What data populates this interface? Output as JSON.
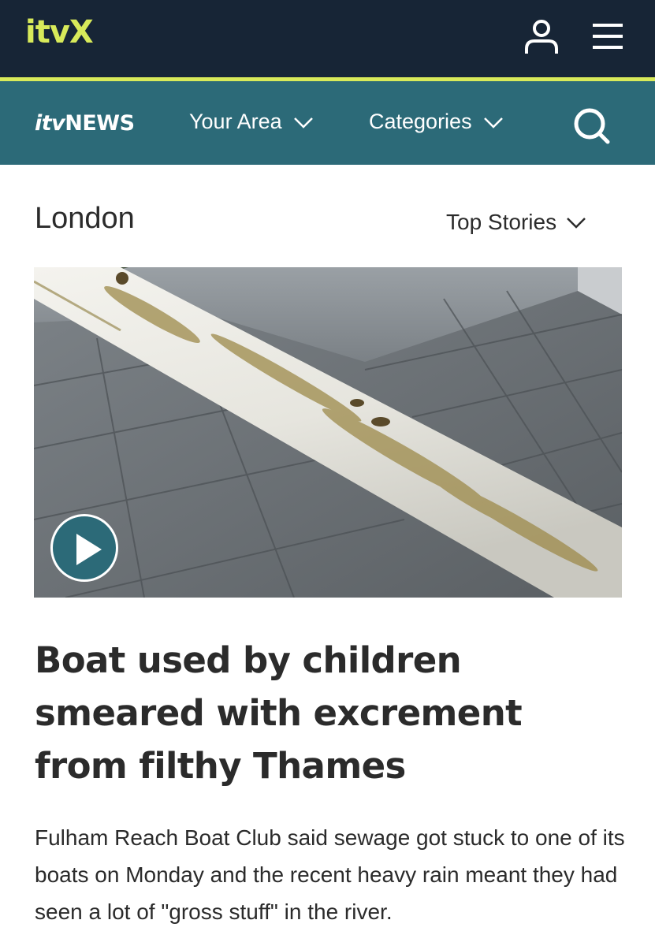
{
  "brand": {
    "logo_text": "itvX",
    "colors": {
      "topbar": "#172536",
      "accent": "#d8ea5a",
      "newsbar": "#2c6a78"
    }
  },
  "header": {
    "account_icon": "person-icon",
    "menu_icon": "hamburger-menu-icon"
  },
  "news_nav": {
    "logo_text_prefix": "itv",
    "logo_text_suffix": "NEWS",
    "items": [
      {
        "label": "Your Area",
        "icon": "chevron-down-icon"
      },
      {
        "label": "Categories",
        "icon": "chevron-down-icon"
      }
    ],
    "search_icon": "search-icon"
  },
  "section": {
    "region": "London",
    "filter_label": "Top Stories"
  },
  "article": {
    "image_description_icon": "play-icon",
    "headline": "Boat used by children smeared with excrement from filthy Thames",
    "summary": "Fulham Reach Boat Club said sewage got stuck to one of its boats on Monday and the recent heavy rain meant they had seen a lot of \"gross stuff\" in the river."
  }
}
